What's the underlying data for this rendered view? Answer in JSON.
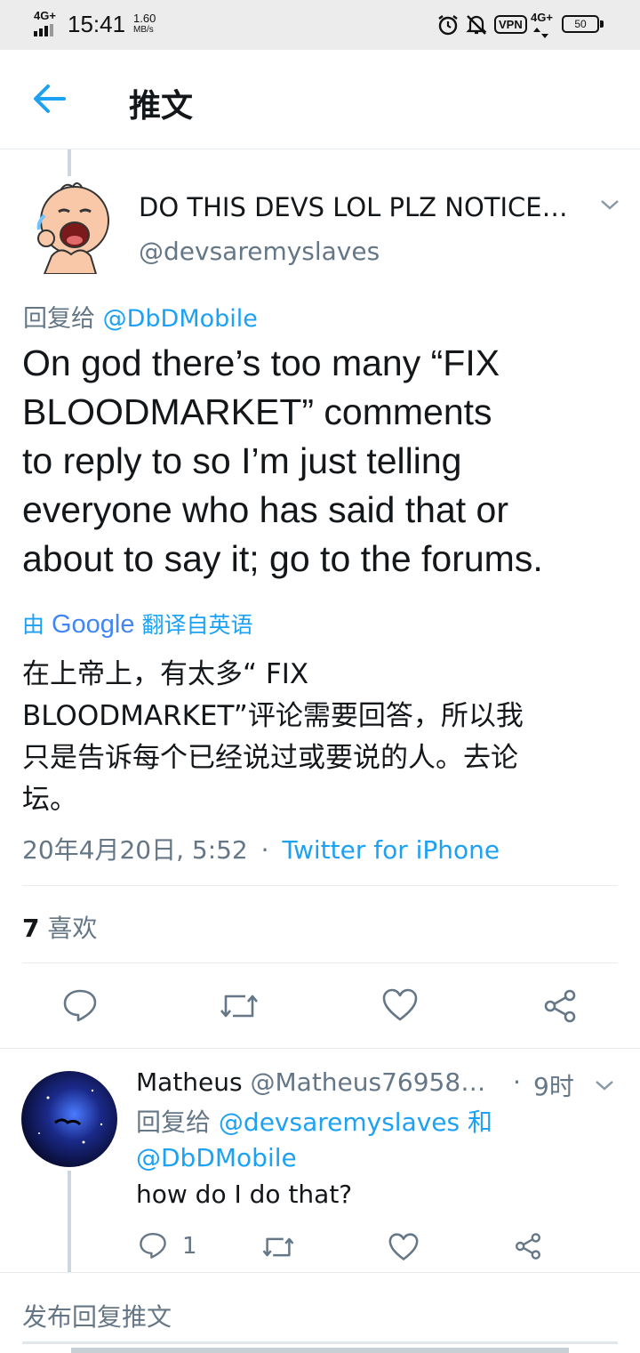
{
  "status_bar": {
    "network": "4G+",
    "time": "15:41",
    "speed": "1.60",
    "speed_unit": "MB/s",
    "vpn": "VPN",
    "network_right": "4G+",
    "battery": "50"
  },
  "header": {
    "title": "推文"
  },
  "tweet": {
    "display_name": "DO THIS DEVS LOL PLZ NOTICE…",
    "handle": "@devsaremyslaves",
    "reply_prefix": "回复给",
    "reply_to": "@DbDMobile",
    "text_lines": [
      "On god there’s too many “FIX",
      "BLOODMARKET” comments",
      "to reply to so I’m just telling",
      "everyone who has said that or",
      "about to say it; go to the forums."
    ],
    "translate_prefix": "由",
    "translate_brand": "Google",
    "translate_suffix": "翻译自英语",
    "translation_lines": [
      "在上帝上，有太多“ FIX",
      "BLOODMARKET”评论需要回答，所以我",
      "只是告诉每个已经说过或要说的人。去论",
      "坛。"
    ],
    "timestamp": "20年4月20日, 5:52",
    "separator": "·",
    "source": "Twitter for iPhone",
    "likes_count": "7",
    "likes_label": "喜欢"
  },
  "reply": {
    "display_name": "Matheus",
    "handle": "@Matheus76958…",
    "dot": "·",
    "time": "9时",
    "reply_prefix": "回复给",
    "reply_to_1": "@devsaremyslaves",
    "and": "和",
    "reply_to_2": "@DbDMobile",
    "text": "how do I do that?",
    "reply_count": "1"
  },
  "compose": {
    "placeholder": "发布回复推文"
  },
  "colors": {
    "accent": "#1da1f2",
    "secondary_text": "#657786",
    "divider": "#e6ecf0"
  }
}
